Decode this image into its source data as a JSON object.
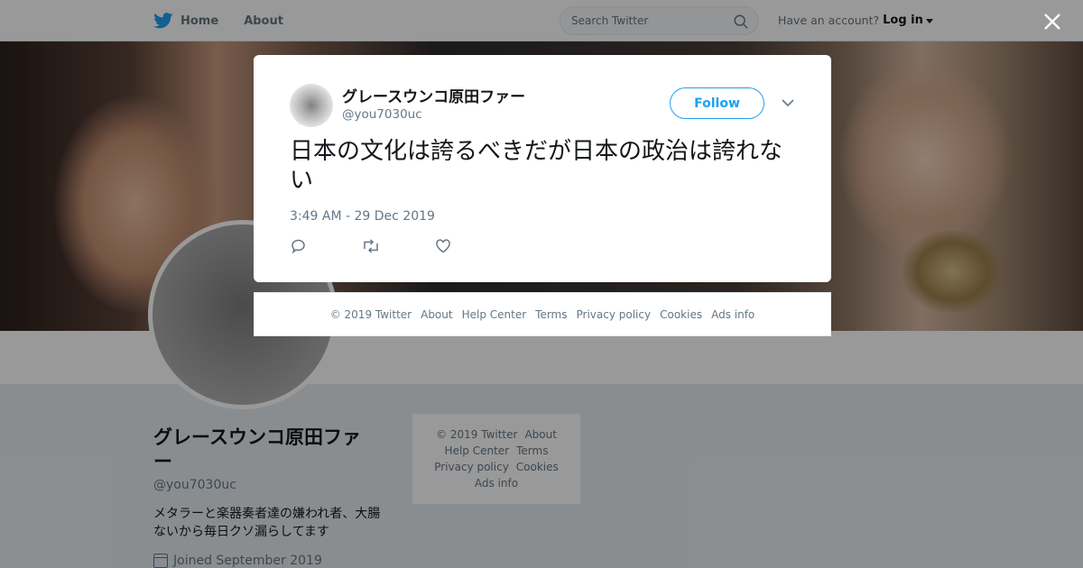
{
  "topbar": {
    "home_label": "Home",
    "about_label": "About",
    "search_placeholder": "Search Twitter",
    "account_prompt": "Have an account?",
    "login_label": "Log in"
  },
  "profile": {
    "name": "グレースウンコ原田ファー",
    "handle": "@you7030uc",
    "bio": "メタラーと楽器奏者達の嫌われ者、大腸ないから毎日クソ漏らしてます",
    "joined": "Joined September 2019"
  },
  "side_footer": {
    "copyright": "© 2019 Twitter",
    "about": "About",
    "help": "Help Center",
    "terms": "Terms",
    "privacy": "Privacy policy",
    "cookies": "Cookies",
    "ads": "Ads info"
  },
  "tweet": {
    "author_name": "グレースウンコ原田ファー",
    "author_handle": "@you7030uc",
    "follow_label": "Follow",
    "text": "日本の文化は誇るべきだが日本の政治は誇れない",
    "timestamp": "3:49 AM - 29 Dec 2019",
    "icons": {
      "reply": "reply-icon",
      "retweet": "retweet-icon",
      "like": "heart-icon",
      "more": "chevron-down-icon",
      "close": "close-icon"
    }
  },
  "modal_footer": {
    "copyright": "© 2019 Twitter",
    "about": "About",
    "help": "Help Center",
    "terms": "Terms",
    "privacy": "Privacy policy",
    "cookies": "Cookies",
    "ads": "Ads info"
  },
  "colors": {
    "accent": "#1da1f2",
    "muted_text": "#657786",
    "overlay": "rgba(0,0,0,0.4)"
  }
}
